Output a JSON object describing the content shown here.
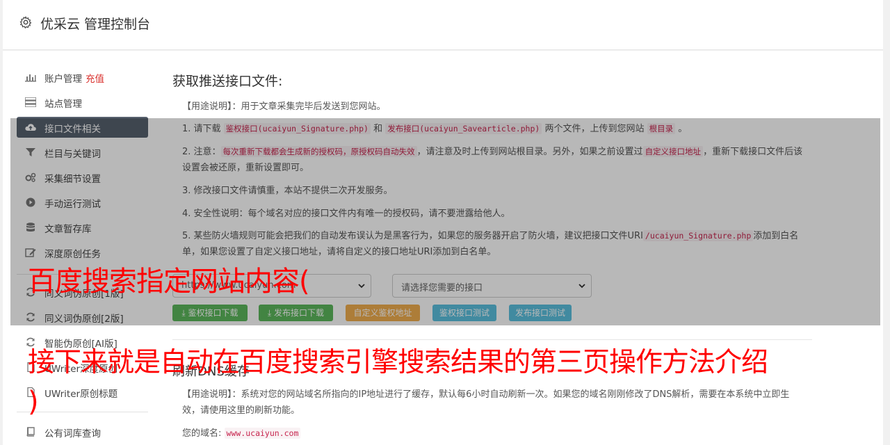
{
  "header": {
    "title": "优采云 管理控制台",
    "icon": "gear-icon"
  },
  "sidebar": {
    "items": [
      {
        "label": "账户管理",
        "extra": "充值",
        "icon": "bar-chart-icon",
        "active": false
      },
      {
        "label": "站点管理",
        "icon": "server-icon",
        "active": false
      },
      {
        "label": "接口文件相关",
        "icon": "cloud-upload-icon",
        "active": true
      },
      {
        "label": "栏目与关键词",
        "icon": "filter-icon",
        "active": false
      },
      {
        "label": "采集细节设置",
        "icon": "gears-icon",
        "active": false
      },
      {
        "label": "手动运行测试",
        "icon": "play-circle-icon",
        "active": false
      },
      {
        "label": "文章暂存库",
        "icon": "database-icon",
        "active": false
      },
      {
        "label": "深度原创任务",
        "icon": "edit-icon",
        "active": false
      },
      {
        "label": "同义词伪原创[1版]",
        "icon": "refresh-icon",
        "active": false
      },
      {
        "label": "同义词伪原创[2版]",
        "icon": "refresh-icon",
        "active": false
      },
      {
        "label": "智能伪原创[AI版]",
        "icon": "refresh-icon",
        "active": false
      },
      {
        "label": "UWriter深度原创",
        "icon": "file-icon",
        "active": false
      },
      {
        "label": "UWriter原创标题",
        "icon": "file-icon",
        "active": false
      },
      {
        "label": "公有词库查询",
        "icon": "book-icon",
        "active": false
      }
    ]
  },
  "main": {
    "section1": {
      "title": "获取推送接口文件:",
      "usage": "【用途说明】：用于文章采集完毕后发送到您网站。",
      "item1_pre": "1. 请下载",
      "item1_code1": "鉴权接口(ucaiyun_Signature.php)",
      "item1_mid": "和",
      "item1_code2": "发布接口(ucaiyun_Savearticle.php)",
      "item1_post": "两个文件，上传到您网站",
      "item1_code3": "根目录",
      "item1_end": "。",
      "item2_pre": "2. 注意：",
      "item2_code1": "每次重新下载都会生成新的授权码，原授权码自动失效",
      "item2_mid": "，请注意及时上传到网站根目录。另外，如果之前设置过",
      "item2_code2": "自定义接口地址",
      "item2_post": "，重新下载接口文件后该设置会被还原，重新设置即可。",
      "item3": "3. 修改接口文件请慎重，本站不提供二次开发服务。",
      "item4": "4. 安全性说明：每个域名对应的接口文件内有唯一的授权码，请不要泄露给他人。",
      "item5_pre": "5. 某些防火墙规则可能会把我们的自动发布误认为是黑客行为，如果您的服务器开启了防火墙，建议把接口文件URI",
      "item5_code": "/ucaiyun_Signature.php",
      "item5_post": "添加到白名单，如果您设置了自定义接口地址，请将自定义的接口地址URI添加到白名单。",
      "select_site": "https://www.ucaiyun.com",
      "select_api": "请选择您需要的接口",
      "buttons": {
        "b1": "鉴权接口下载",
        "b2": "发布接口下载",
        "b3": "自定义鉴权地址",
        "b4": "鉴权接口测试",
        "b5": "发布接口测试"
      }
    },
    "section2": {
      "title": "刷新DNS缓存",
      "usage": "【用途说明】：系统对您的网站域名所指向的IP地址进行了缓存，默认每6小时自动刷新一次。如果您的域名刚刚修改了DNS解析，需要在本系统中立即生效，请使用这里的刷新功能。",
      "domain_label": "您的域名:",
      "domain_value": "www.ucaiyun.com"
    }
  },
  "overlay_text": {
    "line1": "百度搜索指定网站内容(",
    "line2": "接下来就是自动在百度搜索引擎搜索结果的第三页操作方法介绍",
    "line3": ")"
  },
  "colors": {
    "active_bg": "#57616e",
    "green": "#5cb85c",
    "orange": "#f0ad4e",
    "blue": "#5bc0de",
    "red_text": "#ff0000"
  }
}
